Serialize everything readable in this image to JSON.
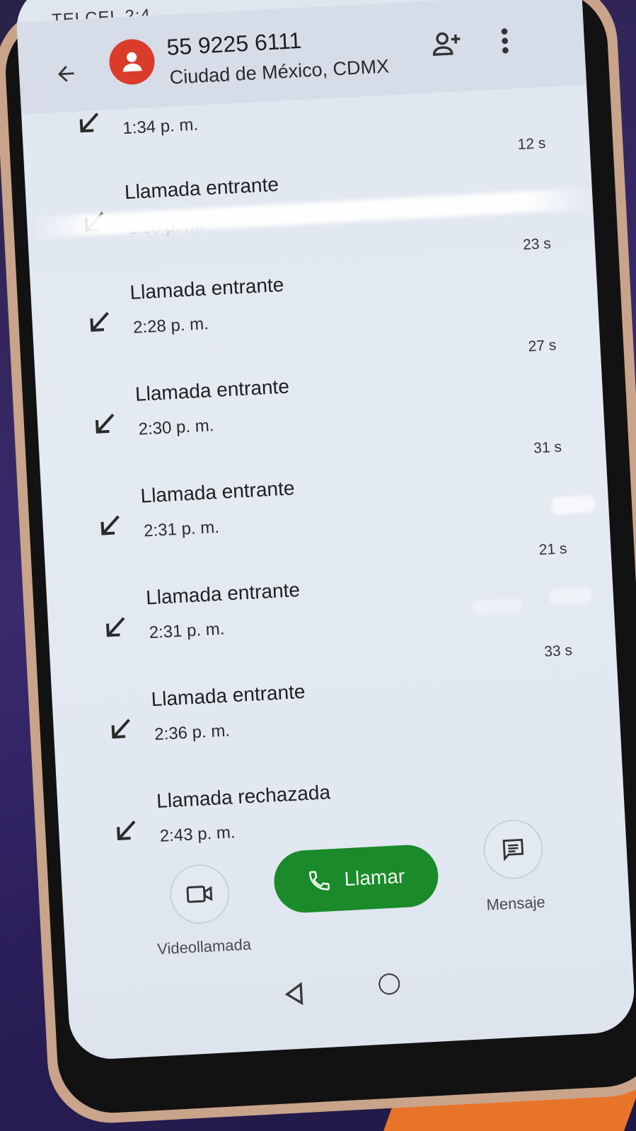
{
  "status_bar": {
    "carrier": "TELCEL 2:4"
  },
  "header": {
    "phone_number": "55 9225 6111",
    "location": "Ciudad de México, CDMX"
  },
  "calls": [
    {
      "type": "",
      "time": "1:34 p. m.",
      "duration": ""
    },
    {
      "type": "Llamada entrante",
      "time": "1:38 p. m.",
      "duration": "12 s"
    },
    {
      "type": "Llamada entrante",
      "time": "2:28 p. m.",
      "duration": "23 s"
    },
    {
      "type": "Llamada entrante",
      "time": "2:30 p. m.",
      "duration": "27 s"
    },
    {
      "type": "Llamada entrante",
      "time": "2:31 p. m.",
      "duration": "31 s"
    },
    {
      "type": "Llamada entrante",
      "time": "2:31 p. m.",
      "duration": "21 s"
    },
    {
      "type": "Llamada entrante",
      "time": "2:36 p. m.",
      "duration": "33 s"
    },
    {
      "type": "Llamada rechazada",
      "time": "2:43 p. m.",
      "duration": ""
    }
  ],
  "actions": {
    "video_label": "Videollamada",
    "call_label": "Llamar",
    "message_label": "Mensaje"
  },
  "icons": {
    "back": "arrow-left-icon",
    "avatar": "person-icon",
    "add_contact": "person-add-icon",
    "more": "more-vert-icon",
    "incoming": "call-received-icon",
    "video": "videocam-icon",
    "phone": "phone-icon",
    "message": "message-icon"
  },
  "colors": {
    "avatar": "#d93c2a",
    "call_button": "#1a8a2a",
    "screen_bg": "#e2e8f1"
  }
}
